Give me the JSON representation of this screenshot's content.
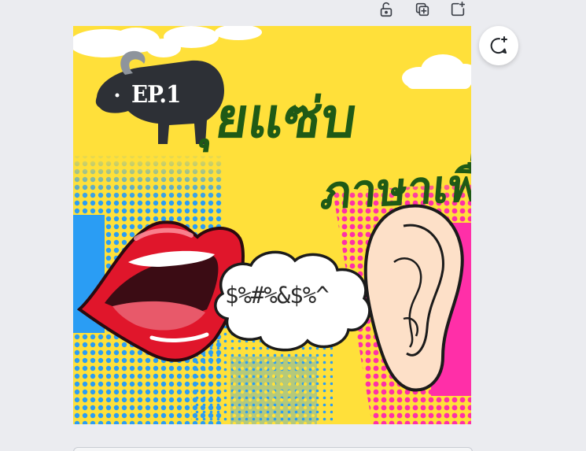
{
  "toolbar": {
    "lock_icon": "lock-open-icon",
    "duplicate_icon": "duplicate-page-icon",
    "add_icon": "add-page-icon"
  },
  "design": {
    "ep_label": "EP.1",
    "title_line_1": "ุยแซ่บ",
    "title_line_2": "ภาษาเพื่อน",
    "bubble_text": "$%#%&$%^",
    "colors": {
      "background_yellow": "#ffe03a",
      "halftone_blue": "#2a9df4",
      "halftone_pink": "#ff2fa8",
      "title_green": "#1f5a16",
      "lips_red": "#e0162b",
      "ear_skin": "#fde0c8"
    }
  },
  "comment_button": {
    "icon": "add-comment-icon"
  }
}
